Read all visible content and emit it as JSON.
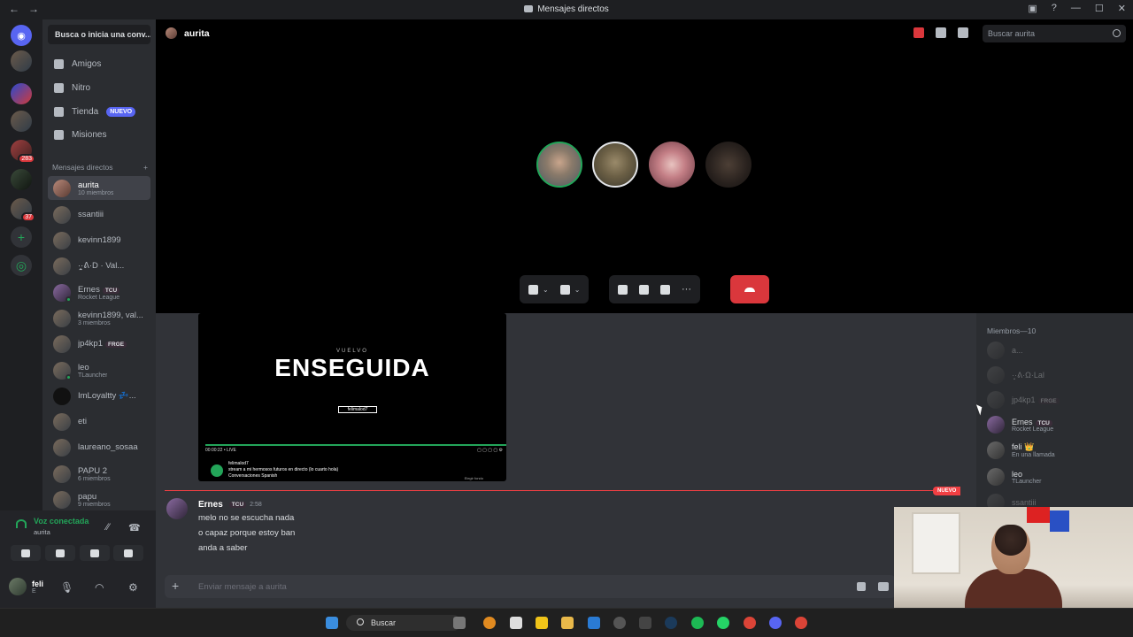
{
  "window": {
    "title": "Mensajes directos",
    "nav_back": "←",
    "nav_fwd": "→",
    "min": "—",
    "max": "☐",
    "close": "✕"
  },
  "guilds": [
    {
      "name": "discord-home-icon",
      "badge": ""
    },
    {
      "name": "server-1",
      "badge": ""
    },
    {
      "name": "server-2",
      "badge": ""
    },
    {
      "name": "server-3",
      "badge": ""
    },
    {
      "name": "server-4",
      "badge": "283"
    },
    {
      "name": "server-5",
      "badge": ""
    },
    {
      "name": "server-6",
      "badge": "37"
    }
  ],
  "dm_search": "Busca o inicia una conv...",
  "menu": {
    "friends": "Amigos",
    "nitro": "Nitro",
    "shop": "Tienda",
    "shop_badge": "NUEVO",
    "quests": "Misiones"
  },
  "dm_header": "Mensajes directos",
  "dm_add": "+",
  "dms": [
    {
      "name": "aurita",
      "sub": "10 miembros",
      "tag": ""
    },
    {
      "name": "ssantiii",
      "sub": "",
      "tag": ""
    },
    {
      "name": "kevinn1899",
      "sub": "",
      "tag": ""
    },
    {
      "name": "·͙̟̯̰·ᕕ·D · Val...",
      "sub": "",
      "tag": ""
    },
    {
      "name": "Ernes",
      "sub": "Rocket League",
      "tag": "TCU"
    },
    {
      "name": "kevinn1899, val...",
      "sub": "3 miembros",
      "tag": ""
    },
    {
      "name": "jp4kp1",
      "sub": "",
      "tag": "FRGE"
    },
    {
      "name": "leo",
      "sub": "TLauncher",
      "tag": ""
    },
    {
      "name": "ImLoyaltty 💤...",
      "sub": "",
      "tag": ""
    },
    {
      "name": "eti",
      "sub": "",
      "tag": ""
    },
    {
      "name": "laureano_sosaa",
      "sub": "",
      "tag": ""
    },
    {
      "name": "PAPU 2",
      "sub": "6 miembros",
      "tag": ""
    },
    {
      "name": "papu",
      "sub": "9 miembros",
      "tag": ""
    }
  ],
  "voice": {
    "status": "Voz conectada",
    "channel": "aurita"
  },
  "user": {
    "name": "feli",
    "sub": "E"
  },
  "call": {
    "title": "aurita",
    "search_placeholder": "Buscar aurita"
  },
  "stream": {
    "small": "VUELVO",
    "big": "ENSEGUIDA",
    "handle": "felimalod7",
    "time": "00:00:22 • LIVE",
    "channel": "felimalod7",
    "desc": "stream a mi hermosos futuros en directo (lo cuarto hola)",
    "tags": "Conversaciones  Spanish",
    "button": "Elegir fondo"
  },
  "chat": {
    "new_badge": "NUEVO",
    "author": "Ernes",
    "author_tag": "TCU",
    "time": "2:58",
    "lines": [
      "melo no se escucha nada",
      "o capaz porque estoy ban",
      "anda a saber"
    ],
    "composer_placeholder": "Enviar mensaje a aurita"
  },
  "members": {
    "header": "Miembros—10",
    "list": [
      {
        "name": "a...",
        "sub": "",
        "tag": "",
        "off": true
      },
      {
        "name": "·͙̟·ᕕ·Ω·Lal",
        "sub": "",
        "tag": "",
        "off": true
      },
      {
        "name": "jp4kp1",
        "sub": "",
        "tag": "FRGE",
        "off": true
      },
      {
        "name": "Ernes",
        "sub": "Rocket League",
        "tag": "TCU",
        "off": false
      },
      {
        "name": "feli 👑",
        "sub": "En una llamada",
        "tag": "",
        "off": false
      },
      {
        "name": "leo",
        "sub": "TLauncher",
        "tag": "",
        "off": false
      },
      {
        "name": "ssantiii",
        "sub": "",
        "tag": "",
        "off": true
      }
    ]
  },
  "taskbar": {
    "search": "Buscar"
  },
  "colors": {
    "green": "#23a559",
    "red": "#da373c",
    "blurple": "#5865f2",
    "bg": "#313338"
  }
}
